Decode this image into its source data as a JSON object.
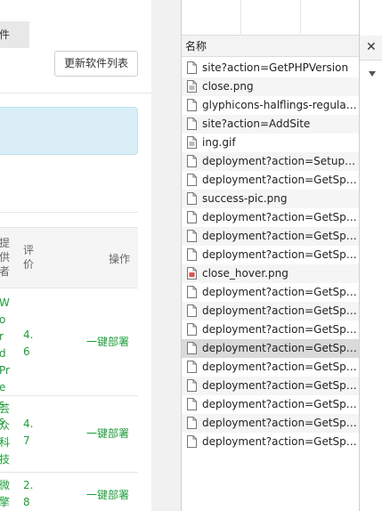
{
  "left": {
    "tab_label": "件",
    "update_button": "更新软件列表",
    "table": {
      "col_provider": "提供者",
      "col_rating": "评价",
      "col_action": "操作",
      "rows": [
        {
          "name": "WordPress",
          "rating": "4.6",
          "action": "一键部署"
        },
        {
          "name": "芸众科技",
          "rating": "4.7",
          "action": "一键部署"
        },
        {
          "name": "微擎",
          "rating": "2.8",
          "action": "一键部署"
        }
      ]
    }
  },
  "network": {
    "column_name": "名称",
    "requests": [
      {
        "name": "site?action=GetPHPVersion",
        "icon": "doc-icon"
      },
      {
        "name": "close.png",
        "icon": "image-icon"
      },
      {
        "name": "glyphicons-halflings-regular.w...",
        "icon": "doc-icon"
      },
      {
        "name": "site?action=AddSite",
        "icon": "doc-icon"
      },
      {
        "name": "ing.gif",
        "icon": "image-icon"
      },
      {
        "name": "deployment?action=SetupPac...",
        "icon": "doc-icon"
      },
      {
        "name": "deployment?action=GetSpeed",
        "icon": "doc-icon"
      },
      {
        "name": "success-pic.png",
        "icon": "doc-icon"
      },
      {
        "name": "deployment?action=GetSpeed",
        "icon": "doc-icon"
      },
      {
        "name": "deployment?action=GetSpeed",
        "icon": "doc-icon"
      },
      {
        "name": "deployment?action=GetSpeed",
        "icon": "doc-icon"
      },
      {
        "name": "close_hover.png",
        "icon": "red-image-icon"
      },
      {
        "name": "deployment?action=GetSpeed",
        "icon": "doc-icon"
      },
      {
        "name": "deployment?action=GetSpeed",
        "icon": "doc-icon"
      },
      {
        "name": "deployment?action=GetSpeed",
        "icon": "doc-icon"
      },
      {
        "name": "deployment?action=GetSpeed",
        "icon": "doc-icon",
        "selected": true
      },
      {
        "name": "deployment?action=GetSpeed",
        "icon": "doc-icon"
      },
      {
        "name": "deployment?action=GetSpeed",
        "icon": "doc-icon"
      },
      {
        "name": "deployment?action=GetSpeed",
        "icon": "doc-icon"
      },
      {
        "name": "deployment?action=GetSpeed",
        "icon": "doc-icon"
      },
      {
        "name": "deployment?action=GetSpeed",
        "icon": "doc-icon"
      }
    ]
  },
  "detail": {
    "close_icon": "close-icon",
    "expand_icon": "triangle-down-icon"
  },
  "colors": {
    "link_green": "#1e9e3a",
    "alert_bg": "#d9eef7",
    "selected_row": "#dadada",
    "alt_row": "#f5f5f5"
  }
}
